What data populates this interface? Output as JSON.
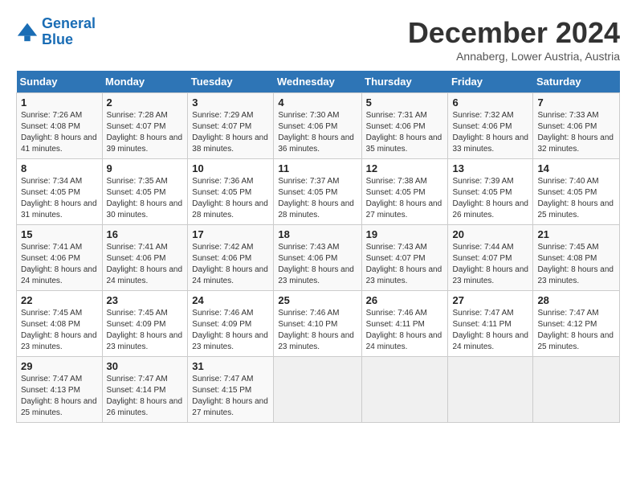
{
  "logo": {
    "line1": "General",
    "line2": "Blue"
  },
  "title": "December 2024",
  "subtitle": "Annaberg, Lower Austria, Austria",
  "days_of_week": [
    "Sunday",
    "Monday",
    "Tuesday",
    "Wednesday",
    "Thursday",
    "Friday",
    "Saturday"
  ],
  "weeks": [
    [
      {
        "day": "1",
        "sunrise": "Sunrise: 7:26 AM",
        "sunset": "Sunset: 4:08 PM",
        "daylight": "Daylight: 8 hours and 41 minutes."
      },
      {
        "day": "2",
        "sunrise": "Sunrise: 7:28 AM",
        "sunset": "Sunset: 4:07 PM",
        "daylight": "Daylight: 8 hours and 39 minutes."
      },
      {
        "day": "3",
        "sunrise": "Sunrise: 7:29 AM",
        "sunset": "Sunset: 4:07 PM",
        "daylight": "Daylight: 8 hours and 38 minutes."
      },
      {
        "day": "4",
        "sunrise": "Sunrise: 7:30 AM",
        "sunset": "Sunset: 4:06 PM",
        "daylight": "Daylight: 8 hours and 36 minutes."
      },
      {
        "day": "5",
        "sunrise": "Sunrise: 7:31 AM",
        "sunset": "Sunset: 4:06 PM",
        "daylight": "Daylight: 8 hours and 35 minutes."
      },
      {
        "day": "6",
        "sunrise": "Sunrise: 7:32 AM",
        "sunset": "Sunset: 4:06 PM",
        "daylight": "Daylight: 8 hours and 33 minutes."
      },
      {
        "day": "7",
        "sunrise": "Sunrise: 7:33 AM",
        "sunset": "Sunset: 4:06 PM",
        "daylight": "Daylight: 8 hours and 32 minutes."
      }
    ],
    [
      {
        "day": "8",
        "sunrise": "Sunrise: 7:34 AM",
        "sunset": "Sunset: 4:05 PM",
        "daylight": "Daylight: 8 hours and 31 minutes."
      },
      {
        "day": "9",
        "sunrise": "Sunrise: 7:35 AM",
        "sunset": "Sunset: 4:05 PM",
        "daylight": "Daylight: 8 hours and 30 minutes."
      },
      {
        "day": "10",
        "sunrise": "Sunrise: 7:36 AM",
        "sunset": "Sunset: 4:05 PM",
        "daylight": "Daylight: 8 hours and 28 minutes."
      },
      {
        "day": "11",
        "sunrise": "Sunrise: 7:37 AM",
        "sunset": "Sunset: 4:05 PM",
        "daylight": "Daylight: 8 hours and 28 minutes."
      },
      {
        "day": "12",
        "sunrise": "Sunrise: 7:38 AM",
        "sunset": "Sunset: 4:05 PM",
        "daylight": "Daylight: 8 hours and 27 minutes."
      },
      {
        "day": "13",
        "sunrise": "Sunrise: 7:39 AM",
        "sunset": "Sunset: 4:05 PM",
        "daylight": "Daylight: 8 hours and 26 minutes."
      },
      {
        "day": "14",
        "sunrise": "Sunrise: 7:40 AM",
        "sunset": "Sunset: 4:05 PM",
        "daylight": "Daylight: 8 hours and 25 minutes."
      }
    ],
    [
      {
        "day": "15",
        "sunrise": "Sunrise: 7:41 AM",
        "sunset": "Sunset: 4:06 PM",
        "daylight": "Daylight: 8 hours and 24 minutes."
      },
      {
        "day": "16",
        "sunrise": "Sunrise: 7:41 AM",
        "sunset": "Sunset: 4:06 PM",
        "daylight": "Daylight: 8 hours and 24 minutes."
      },
      {
        "day": "17",
        "sunrise": "Sunrise: 7:42 AM",
        "sunset": "Sunset: 4:06 PM",
        "daylight": "Daylight: 8 hours and 24 minutes."
      },
      {
        "day": "18",
        "sunrise": "Sunrise: 7:43 AM",
        "sunset": "Sunset: 4:06 PM",
        "daylight": "Daylight: 8 hours and 23 minutes."
      },
      {
        "day": "19",
        "sunrise": "Sunrise: 7:43 AM",
        "sunset": "Sunset: 4:07 PM",
        "daylight": "Daylight: 8 hours and 23 minutes."
      },
      {
        "day": "20",
        "sunrise": "Sunrise: 7:44 AM",
        "sunset": "Sunset: 4:07 PM",
        "daylight": "Daylight: 8 hours and 23 minutes."
      },
      {
        "day": "21",
        "sunrise": "Sunrise: 7:45 AM",
        "sunset": "Sunset: 4:08 PM",
        "daylight": "Daylight: 8 hours and 23 minutes."
      }
    ],
    [
      {
        "day": "22",
        "sunrise": "Sunrise: 7:45 AM",
        "sunset": "Sunset: 4:08 PM",
        "daylight": "Daylight: 8 hours and 23 minutes."
      },
      {
        "day": "23",
        "sunrise": "Sunrise: 7:45 AM",
        "sunset": "Sunset: 4:09 PM",
        "daylight": "Daylight: 8 hours and 23 minutes."
      },
      {
        "day": "24",
        "sunrise": "Sunrise: 7:46 AM",
        "sunset": "Sunset: 4:09 PM",
        "daylight": "Daylight: 8 hours and 23 minutes."
      },
      {
        "day": "25",
        "sunrise": "Sunrise: 7:46 AM",
        "sunset": "Sunset: 4:10 PM",
        "daylight": "Daylight: 8 hours and 23 minutes."
      },
      {
        "day": "26",
        "sunrise": "Sunrise: 7:46 AM",
        "sunset": "Sunset: 4:11 PM",
        "daylight": "Daylight: 8 hours and 24 minutes."
      },
      {
        "day": "27",
        "sunrise": "Sunrise: 7:47 AM",
        "sunset": "Sunset: 4:11 PM",
        "daylight": "Daylight: 8 hours and 24 minutes."
      },
      {
        "day": "28",
        "sunrise": "Sunrise: 7:47 AM",
        "sunset": "Sunset: 4:12 PM",
        "daylight": "Daylight: 8 hours and 25 minutes."
      }
    ],
    [
      {
        "day": "29",
        "sunrise": "Sunrise: 7:47 AM",
        "sunset": "Sunset: 4:13 PM",
        "daylight": "Daylight: 8 hours and 25 minutes."
      },
      {
        "day": "30",
        "sunrise": "Sunrise: 7:47 AM",
        "sunset": "Sunset: 4:14 PM",
        "daylight": "Daylight: 8 hours and 26 minutes."
      },
      {
        "day": "31",
        "sunrise": "Sunrise: 7:47 AM",
        "sunset": "Sunset: 4:15 PM",
        "daylight": "Daylight: 8 hours and 27 minutes."
      },
      null,
      null,
      null,
      null
    ]
  ]
}
